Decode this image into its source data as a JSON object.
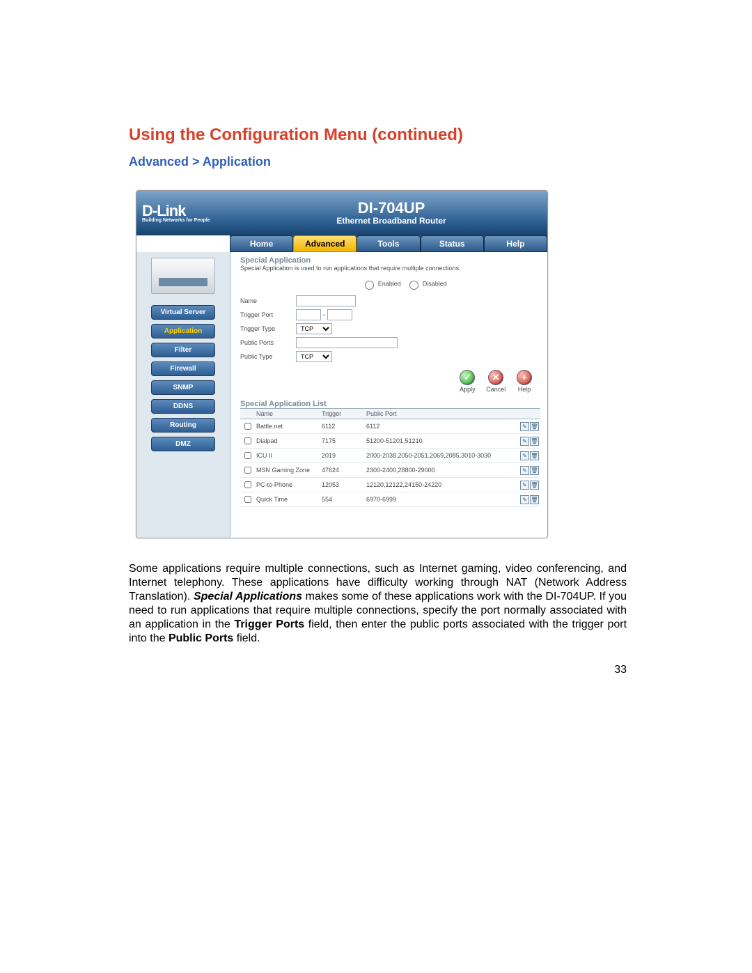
{
  "doc": {
    "heading": "Using the Configuration Menu (continued)",
    "breadcrumb": "Advanced > Application",
    "paragraph_a": "Some applications require multiple connections, such as Internet gaming, video conferencing, and Internet telephony. These applications have difficulty working through NAT (Network Address Translation). ",
    "paragraph_b": "Special Applications",
    "paragraph_c": " makes some of these applications work with the DI-704UP. If you need to run applications that require multiple connections, specify the port normally associated with an application in the ",
    "paragraph_d": "Trigger Ports",
    "paragraph_e": " field, then enter the public ports associated with the trigger port into the ",
    "paragraph_f": "Public Ports",
    "paragraph_g": " field.",
    "page_number": "33"
  },
  "router": {
    "brand": "D-Link",
    "brand_tag": "Building Networks for People",
    "model": "DI-704UP",
    "model_sub": "Ethernet Broadband Router",
    "tabs": [
      "Home",
      "Advanced",
      "Tools",
      "Status",
      "Help"
    ],
    "active_tab": "Advanced",
    "sidebar": [
      "Virtual Server",
      "Application",
      "Filter",
      "Firewall",
      "SNMP",
      "DDNS",
      "Routing",
      "DMZ"
    ],
    "sidebar_active": "Application",
    "section": {
      "title": "Special Application",
      "desc": "Special Application is used to run applications that require multiple connections.",
      "enabled_label": "Enabled",
      "disabled_label": "Disabled",
      "fields": {
        "name": "Name",
        "trigger_port": "Trigger Port",
        "trigger_type": "Trigger Type",
        "public_ports": "Public Ports",
        "public_type": "Public Type"
      },
      "type_value": "TCP",
      "actions": {
        "apply": "Apply",
        "cancel": "Cancel",
        "help": "Help"
      }
    },
    "list": {
      "title": "Special Application List",
      "headers": [
        "",
        "Name",
        "Trigger",
        "Public Port",
        ""
      ],
      "rows": [
        {
          "name": "Battle.net",
          "trigger": "6112",
          "public": "6112"
        },
        {
          "name": "Dialpad",
          "trigger": "7175",
          "public": "51200-51201,51210"
        },
        {
          "name": "ICU II",
          "trigger": "2019",
          "public": "2000-2038,2050-2051,2069,2085,3010-3030"
        },
        {
          "name": "MSN Gaming Zone",
          "trigger": "47624",
          "public": "2300-2400,28800-29000"
        },
        {
          "name": "PC-to-Phone",
          "trigger": "12053",
          "public": "12120,12122,24150-24220"
        },
        {
          "name": "Quick Time",
          "trigger": "554",
          "public": "6970-6999"
        }
      ]
    }
  }
}
